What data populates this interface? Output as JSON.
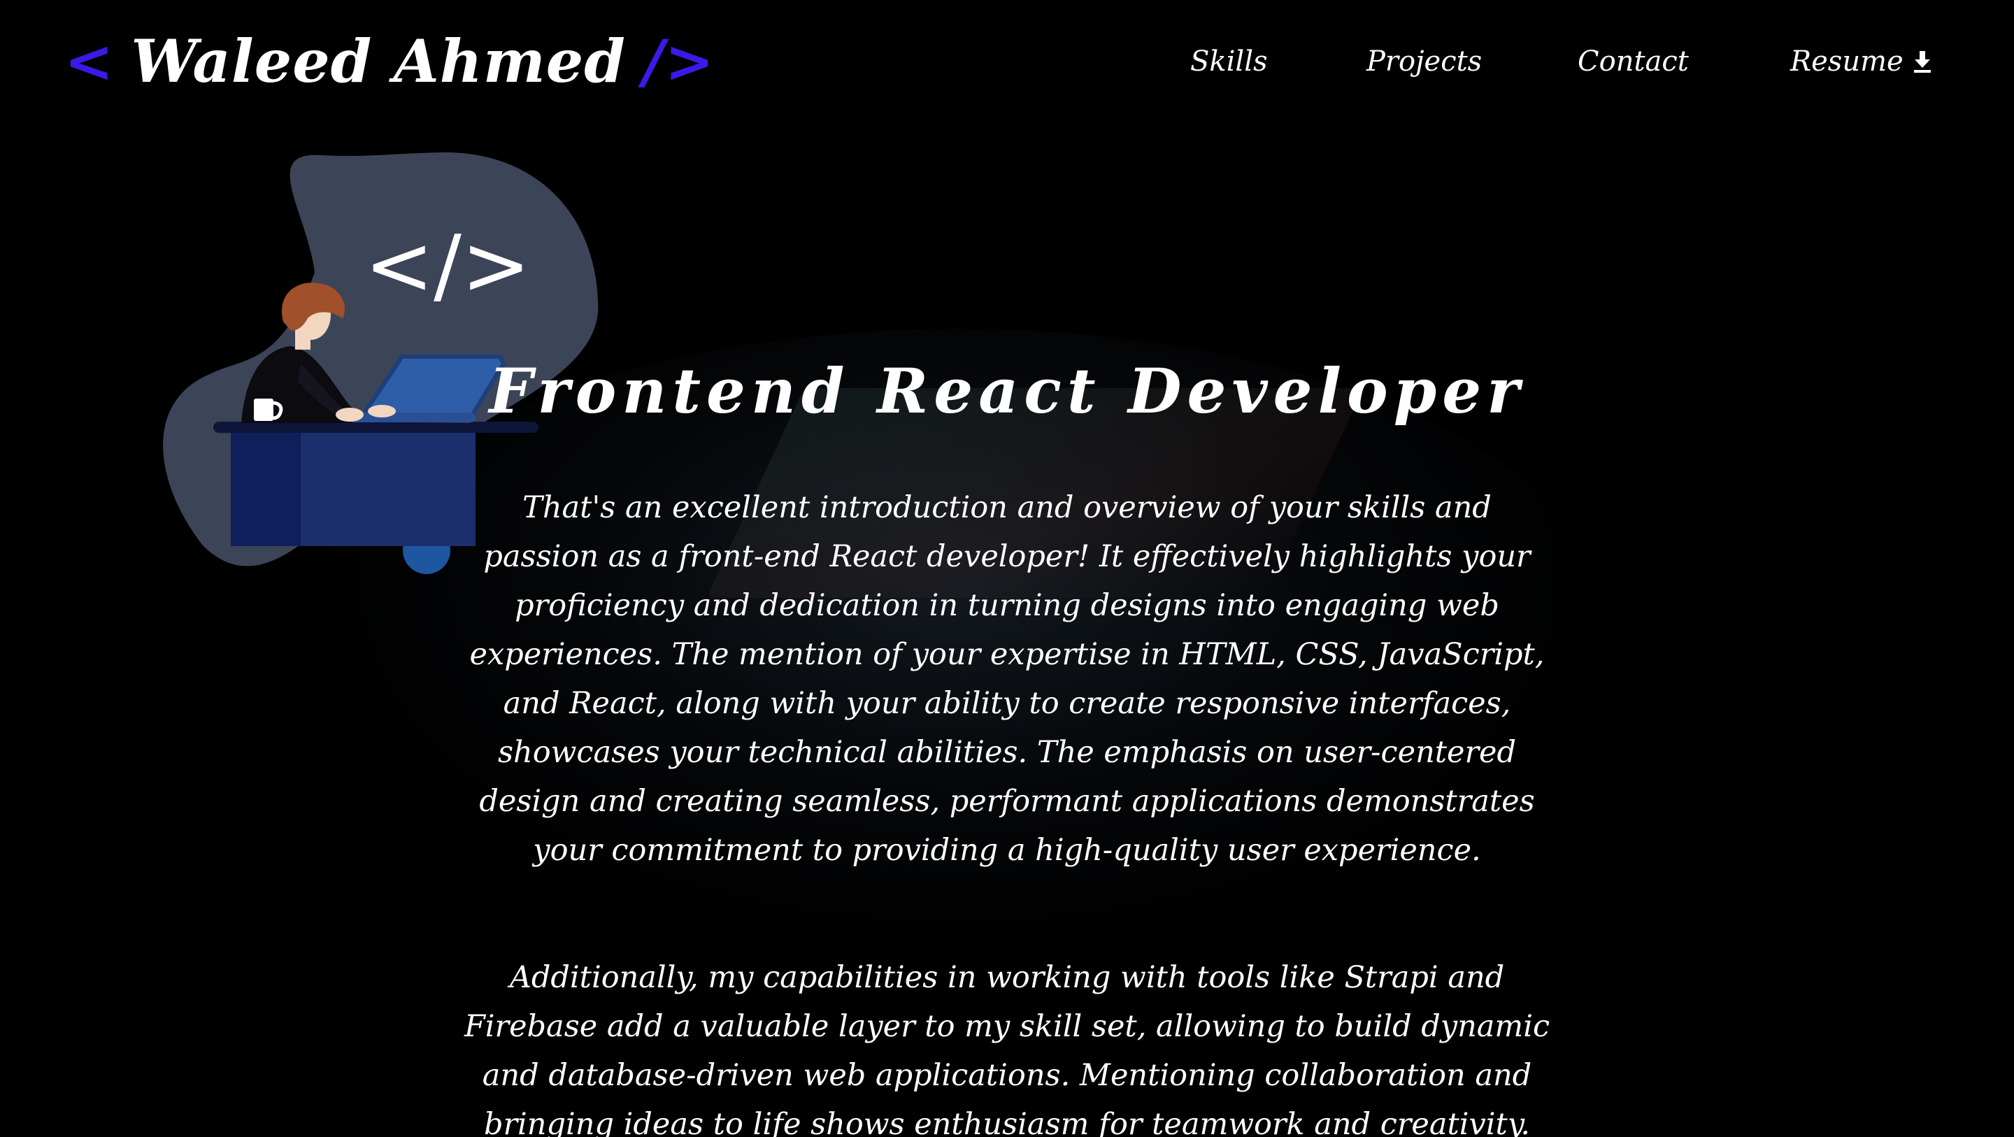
{
  "header": {
    "logo": {
      "open_bracket": "<",
      "name": "Waleed Ahmed",
      "close_bracket": "/>"
    },
    "nav": [
      {
        "label": "Skills"
      },
      {
        "label": "Projects"
      },
      {
        "label": "Contact"
      },
      {
        "label": "Resume",
        "icon": "download-icon"
      }
    ]
  },
  "illustration": {
    "code_symbol": "</>",
    "icon": "developer-at-laptop-illustration"
  },
  "hero": {
    "title": "Frontend React Developer",
    "paragraph_1": "That's an excellent introduction and overview of your skills and passion as a front-end React developer! It effectively highlights your proficiency and dedication in turning designs into engaging web experiences. The mention of your expertise in HTML, CSS, JavaScript, and React, along with your ability to create responsive interfaces, showcases your technical abilities. The emphasis on user-centered design and creating seamless, performant applications demonstrates your commitment to providing a high-quality user experience.",
    "paragraph_2": "Additionally, my capabilities in working with tools like Strapi and Firebase add a valuable layer to my skill set, allowing to build dynamic and database-driven web applications. Mentioning collaboration and bringing ideas to life shows enthusiasm for teamwork and creativity."
  },
  "colors": {
    "background": "#000000",
    "accent": "#3a1ae6",
    "text": "#ffffff",
    "blob": "#3c4557",
    "laptop": "#2f5ea8",
    "desk": "#1a2f6b"
  }
}
